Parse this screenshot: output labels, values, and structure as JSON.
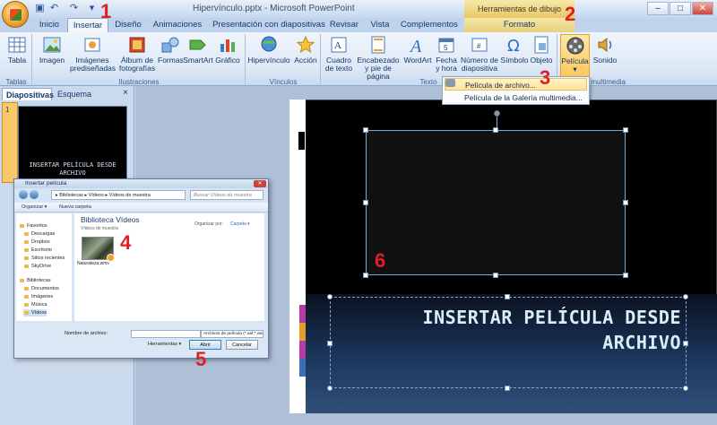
{
  "app": {
    "window_title": "Hipervínculo.pptx - Microsoft PowerPoint",
    "contextual_tab_group": "Herramientas de dibujo"
  },
  "tabs": [
    "Inicio",
    "Insertar",
    "Diseño",
    "Animaciones",
    "Presentación con diapositivas",
    "Revisar",
    "Vista",
    "Complementos",
    "Formato"
  ],
  "ribbon": {
    "groups": [
      "Tablas",
      "Ilustraciones",
      "Vínculos",
      "Texto",
      "Clips multimedia"
    ],
    "buttons": {
      "tabla": "Tabla",
      "imagen": "Imagen",
      "imagenes_prediseñadas": "Imágenes prediseñadas",
      "album": "Álbum de fotografías",
      "formas": "Formas",
      "smartart": "SmartArt",
      "grafico": "Gráfico",
      "hipervinculo": "Hipervínculo",
      "accion": "Acción",
      "cuadro_texto": "Cuadro de texto",
      "encabezado": "Encabezado y pie de página",
      "wordart": "WordArt",
      "fecha_hora": "Fecha y hora",
      "numero_diapositiva": "Número de diapositiva",
      "simbolo": "Símbolo",
      "objeto": "Objeto",
      "pelicula": "Película",
      "sonido": "Sonido"
    }
  },
  "dropdown": {
    "items": [
      "Película de archivo...",
      "Película de la Galería multimedia..."
    ]
  },
  "left_pane": {
    "tabs": [
      "Diapositivas",
      "Esquema"
    ],
    "close": "×",
    "slide_number": "1",
    "thumb_title": "INSERTAR PELÍCULA DESDE ARCHIVO"
  },
  "slide": {
    "title_line1": "INSERTAR PELÍCULA DESDE",
    "title_line2": "ARCHIVO"
  },
  "dialog": {
    "title": "Insertar película",
    "address": "▸ Bibliotecas ▸ Vídeos ▸ Vídeos de muestra",
    "search_placeholder": "Buscar Vídeos de muestra",
    "organize": "Organizar ▾",
    "new_folder": "Nueva carpeta",
    "nav": [
      "Favoritos",
      "Descargas",
      "Dropbox",
      "Escritorio",
      "Sitios recientes",
      "SkyDrive",
      "Bibliotecas",
      "Documentos",
      "Imágenes",
      "Música",
      "Vídeos"
    ],
    "library_title": "Biblioteca Vídeos",
    "library_subtitle": "Vídeos de muestra",
    "arrange_label": "Organizar por:",
    "arrange_value": "Carpeta ▾",
    "file_name": "Naturaleza.wmv",
    "file_name_label": "Nombre de archivo:",
    "file_type": "Archivos de película (*.asf;*.asx;",
    "tools": "Herramientas ▾",
    "open": "Abrir",
    "cancel": "Cancelar"
  },
  "steps": [
    "1",
    "2",
    "3",
    "4",
    "5",
    "6"
  ],
  "colors": {
    "step_red": "#e21d24",
    "ribbon_accent": "#fbc95c",
    "slide_bg": "#000000",
    "title_text": "#d8eef8"
  }
}
